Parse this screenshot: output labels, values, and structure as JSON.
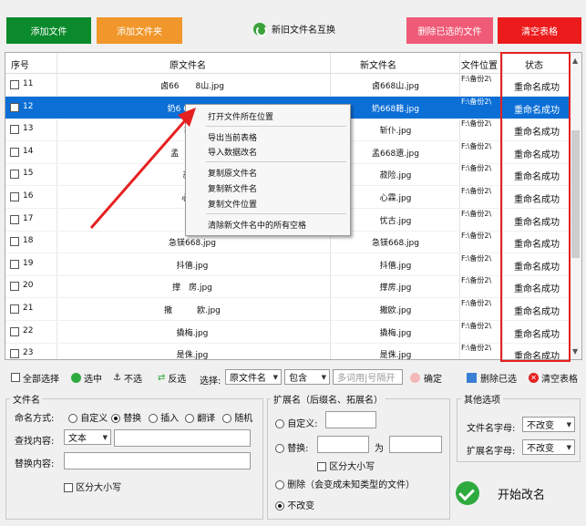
{
  "toolbar": {
    "add_file": "添加文件",
    "add_folder": "添加文件夹",
    "swap_label": "新旧文件名互换",
    "delete_selected": "删除已选的文件",
    "clear_table": "清空表格"
  },
  "colors": {
    "add_file": "#0b8a2b",
    "add_folder": "#f0962a",
    "delete_selected": "#ef5b77",
    "clear_table": "#ec1c1c",
    "selection": "#0c6fd6",
    "highlight_red": "#e52020"
  },
  "table": {
    "headers": {
      "num": "序号",
      "orig": "原文件名",
      "new": "新文件名",
      "loc": "文件位置",
      "status": "状态"
    },
    "rows": [
      {
        "num": "11",
        "orig": "卤66　　8山.jpg",
        "new": "卤668山.jpg",
        "loc": "F:\\备份2\\",
        "status": "重命名成功",
        "selected": false
      },
      {
        "num": "12",
        "orig": "奶6 68籍.jpg",
        "new": "奶668籍.jpg",
        "loc": "F:\\备份2\\",
        "status": "重命名成功",
        "selected": true
      },
      {
        "num": "13",
        "orig": "斩仆",
        "new": "斩仆.jpg",
        "loc": "F:\\备份2\\",
        "status": "重命名成功",
        "selected": false
      },
      {
        "num": "14",
        "orig": "孟　　　68",
        "new": "孟668遗.jpg",
        "loc": "F:\\备份2\\",
        "status": "重命名成功",
        "selected": false
      },
      {
        "num": "15",
        "orig": "菽险.",
        "new": "菽险.jpg",
        "loc": "F:\\备份2\\",
        "status": "重命名成功",
        "selected": false
      },
      {
        "num": "16",
        "orig": "心 霖.",
        "new": "心霖.jpg",
        "loc": "F:\\备份2\\",
        "status": "重命名成功",
        "selected": false
      },
      {
        "num": "17",
        "orig": "忧",
        "new": "忧古.jpg",
        "loc": "F:\\备份2\\",
        "status": "重命名成功",
        "selected": false
      },
      {
        "num": "18",
        "orig": "急镁668.jpg",
        "new": "急镁668.jpg",
        "loc": "F:\\备份2\\",
        "status": "重命名成功",
        "selected": false
      },
      {
        "num": "19",
        "orig": "抖僖.jpg",
        "new": "抖僖.jpg",
        "loc": "F:\\备份2\\",
        "status": "重命名成功",
        "selected": false
      },
      {
        "num": "20",
        "orig": "撑　房.jpg",
        "new": "撑房.jpg",
        "loc": "F:\\备份2\\",
        "status": "重命名成功",
        "selected": false
      },
      {
        "num": "21",
        "orig": "撒　　　欧.jpg",
        "new": "撒欧.jpg",
        "loc": "F:\\备份2\\",
        "status": "重命名成功",
        "selected": false
      },
      {
        "num": "22",
        "orig": "撬梅.jpg",
        "new": "撬梅.jpg",
        "loc": "F:\\备份2\\",
        "status": "重命名成功",
        "selected": false
      },
      {
        "num": "23",
        "orig": "是侏.jpg",
        "new": "是侏.jpg",
        "loc": "F:\\备份2\\",
        "status": "重命名成功",
        "selected": false
      }
    ]
  },
  "context_menu": {
    "items": [
      "打开文件所在位置",
      "导出当前表格",
      "导入数据改名",
      "复制原文件名",
      "复制新文件名",
      "复制文件位置",
      "清除新文件名中的所有空格"
    ]
  },
  "filter_bar": {
    "select_all": "全部选择",
    "select": "选中",
    "deselect": "不选",
    "invert": "反选",
    "choose_label": "选择:",
    "field_value": "原文件名",
    "match_value": "包含",
    "search_placeholder": "多词用|号隔开",
    "confirm": "确定",
    "delete_selected": "删除已选",
    "clear_table": "清空表格"
  },
  "filename_group": {
    "title": "文件名",
    "mode_label": "命名方式:",
    "modes": [
      "自定义",
      "替换",
      "插入",
      "翻译",
      "随机"
    ],
    "mode_selected": "替换",
    "find_label": "查找内容:",
    "find_type": "文本",
    "replace_label": "替换内容:",
    "case_label": "区分大小写"
  },
  "ext_group": {
    "title": "扩展名（后缀名、拓展名）",
    "custom": "自定义:",
    "replace": "替换:",
    "for": "为",
    "case_label": "区分大小写",
    "delete": "删除（会变成未知类型的文件）",
    "keep": "不改变"
  },
  "other_group": {
    "title": "其他选项",
    "filename_case_label": "文件名字母:",
    "filename_case_value": "不改变",
    "ext_case_label": "扩展名字母:",
    "ext_case_value": "不改变"
  },
  "start_label": "开始改名"
}
